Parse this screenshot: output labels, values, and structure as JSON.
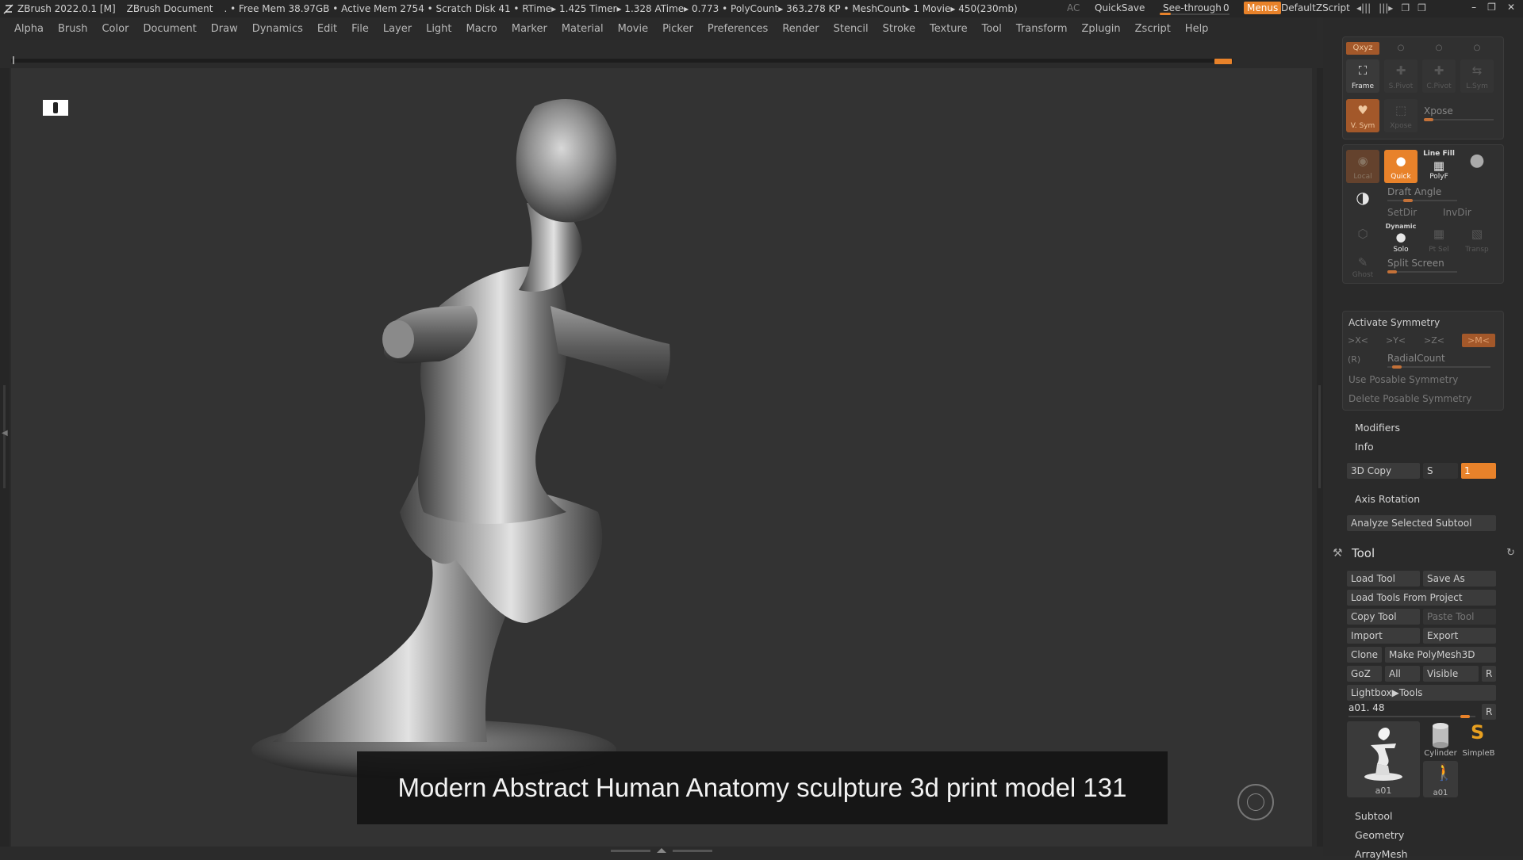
{
  "titlebar": {
    "app": "ZBrush 2022.0.1 [M]",
    "document": "ZBrush Document",
    "stats": ". • Free Mem 38.97GB • Active Mem 2754 • Scratch Disk 41 •  RTime▸ 1.425 Timer▸ 1.328 ATime▸ 0.773 • PolyCount▸ 363.278 KP  • MeshCount▸ 1  Movie▸ 450(230mb)",
    "ac": "AC",
    "quicksave": "QuickSave",
    "see_through_label": "See-through",
    "see_through_value": "0",
    "menus": "Menus",
    "default_zscript": "DefaultZScript",
    "accent": "#e8822a"
  },
  "menubar": [
    "Alpha",
    "Brush",
    "Color",
    "Document",
    "Draw",
    "Dynamics",
    "Edit",
    "File",
    "Layer",
    "Light",
    "Macro",
    "Marker",
    "Material",
    "Movie",
    "Picker",
    "Preferences",
    "Render",
    "Stencil",
    "Stroke",
    "Texture",
    "Tool",
    "Transform",
    "Zplugin",
    "Zscript",
    "Help"
  ],
  "canvas": {
    "caption": "Modern Abstract Human Anatomy sculpture 3d print model 131",
    "background": "#333333"
  },
  "tray": {
    "view_tabs": [
      "Qxyz",
      "",
      "",
      ""
    ],
    "view_tiles": {
      "frame": "Frame",
      "spivot": "S.Pivot",
      "cpivot": "C.Pivot",
      "lsym": "L.Sym",
      "vsym": "V. Sym",
      "xpose_tile": "Xpose",
      "xpose_label": "Xpose"
    },
    "draw_tiles": {
      "local": "Local",
      "quick": "Quick",
      "linefill": "Line Fill",
      "polyf": "PolyF"
    },
    "draft_angle": "Draft Angle",
    "setdir": "SetDir",
    "invdir": "InvDir",
    "dynamic": "Dynamic",
    "solo": "Solo",
    "ptsel": "Pt Sel",
    "transp": "Transp",
    "ghost": "Ghost",
    "split_screen": "Split Screen",
    "symmetry": {
      "activate": "Activate Symmetry",
      "x": ">X<",
      "y": ">Y<",
      "z": ">Z<",
      "m": ">M<",
      "r": "(R)",
      "radial_count": "RadialCount",
      "use_posable": "Use Posable Symmetry",
      "delete_posable": "Delete Posable Symmetry"
    },
    "modifiers": "Modifiers",
    "info": "Info",
    "copy3d": "3D Copy",
    "s_label": "S",
    "s_value": "1",
    "axis_rotation": "Axis Rotation",
    "analyze": "Analyze Selected Subtool",
    "tool": {
      "title": "Tool",
      "load_tool": "Load Tool",
      "save_as": "Save As",
      "load_from_project": "Load Tools From Project",
      "copy_tool": "Copy Tool",
      "paste_tool": "Paste Tool",
      "import": "Import",
      "export": "Export",
      "clone": "Clone",
      "make_polymesh": "Make PolyMesh3D",
      "goz": "GoZ",
      "all": "All",
      "visible": "Visible",
      "r": "R",
      "lightbox": "Lightbox▶Tools",
      "current": "a01. 48",
      "current_r": "R",
      "current_slider": 0.95,
      "thumbs": [
        {
          "name": "a01"
        },
        {
          "name": "Cylinder"
        },
        {
          "name": "SimpleB"
        },
        {
          "name": "a01"
        }
      ]
    },
    "sections": [
      "Subtool",
      "Geometry",
      "ArrayMesh"
    ]
  }
}
